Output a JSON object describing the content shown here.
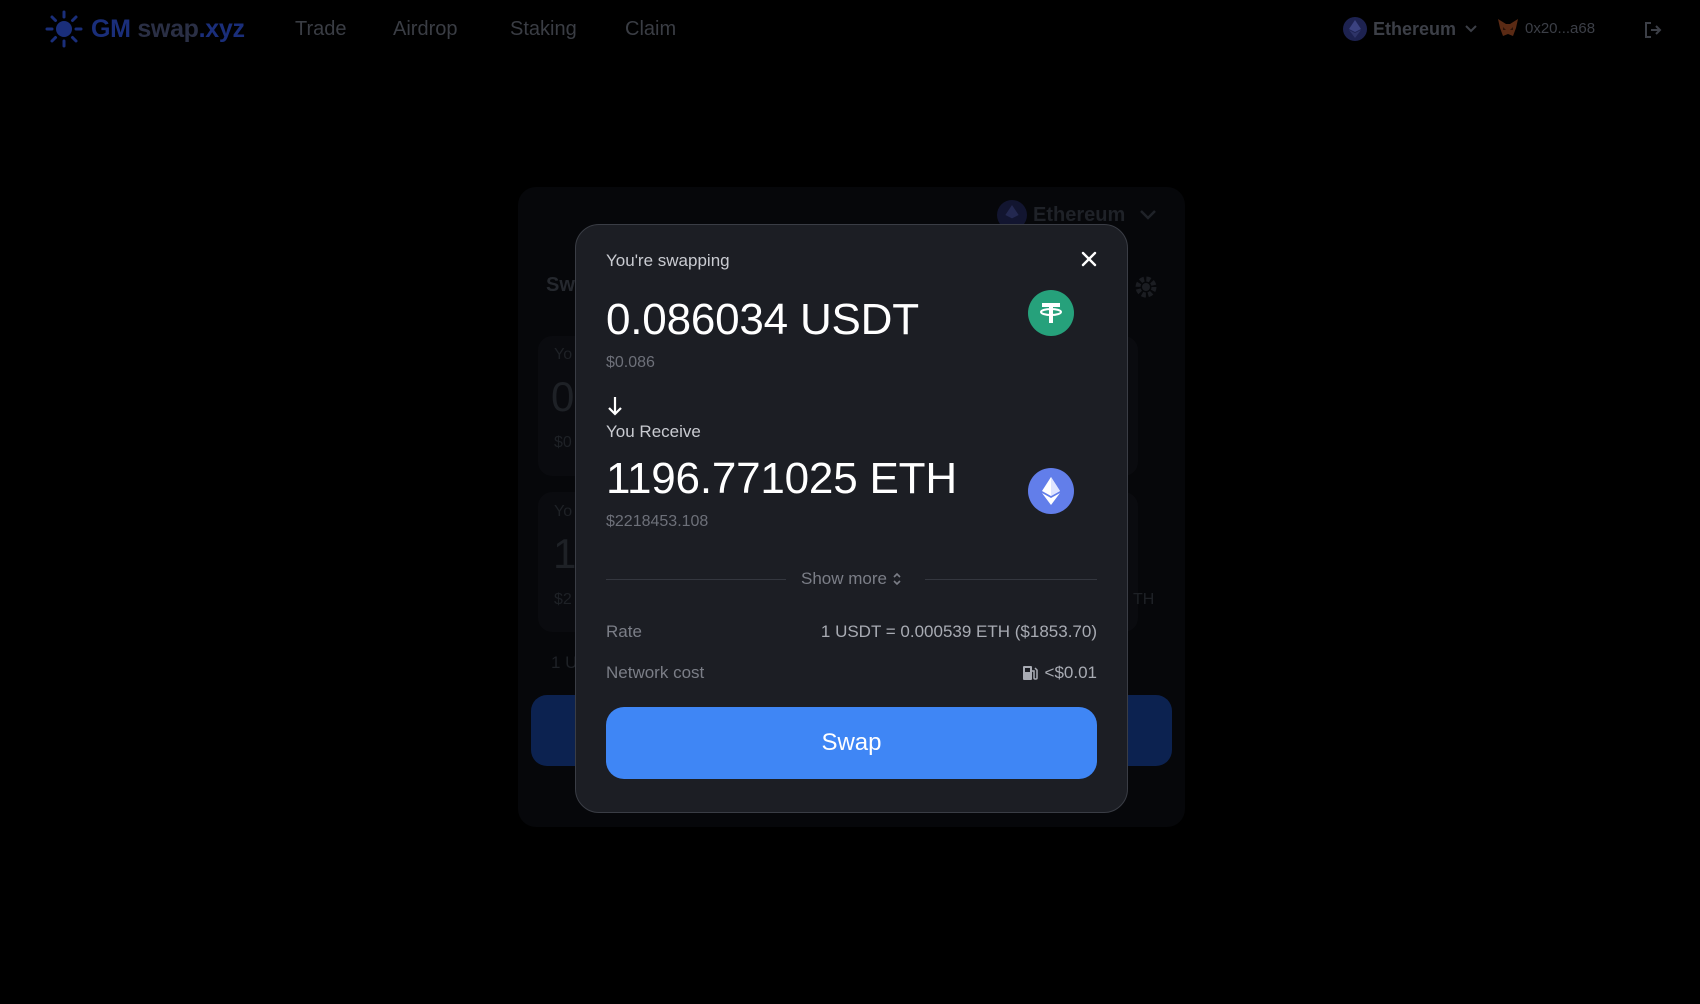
{
  "nav": {
    "logo": {
      "gm": "GM",
      "swap": "swap",
      "xyz": ".xyz",
      "icon": "sun-icon"
    },
    "links": [
      "Trade",
      "Airdrop",
      "Staking",
      "Claim"
    ],
    "network": "Ethereum",
    "wallet": "0x20...a68"
  },
  "background_card": {
    "network": "Ethereum",
    "title_fragment": "Sw",
    "sell_label_fragment": "Yo",
    "sell_amount_fragment": "0",
    "sell_usd_fragment": "$0",
    "buy_label_fragment": "Yo",
    "buy_amount_fragment": "1",
    "buy_usd_fragment": "$2",
    "rate_fragment": "1 U",
    "eth_fragment": "TH"
  },
  "modal": {
    "heading": "You're swapping",
    "sell": {
      "amount": "0.086034 USDT",
      "usd": "$0.086",
      "token_icon": "usdt-icon"
    },
    "receive_label": "You Receive",
    "buy": {
      "amount": "1196.771025 ETH",
      "usd": "$2218453.108",
      "token_icon": "eth-icon"
    },
    "show_more": "Show more",
    "rate_label": "Rate",
    "rate_value": "1 USDT = 0.000539 ETH ($1853.70)",
    "network_cost_label": "Network cost",
    "network_cost_value": "<$0.01",
    "swap_button": "Swap"
  },
  "colors": {
    "accent": "#3f86f5",
    "usdt": "#26a17b",
    "eth": "#627eea",
    "modal_bg": "#1c1e24"
  }
}
